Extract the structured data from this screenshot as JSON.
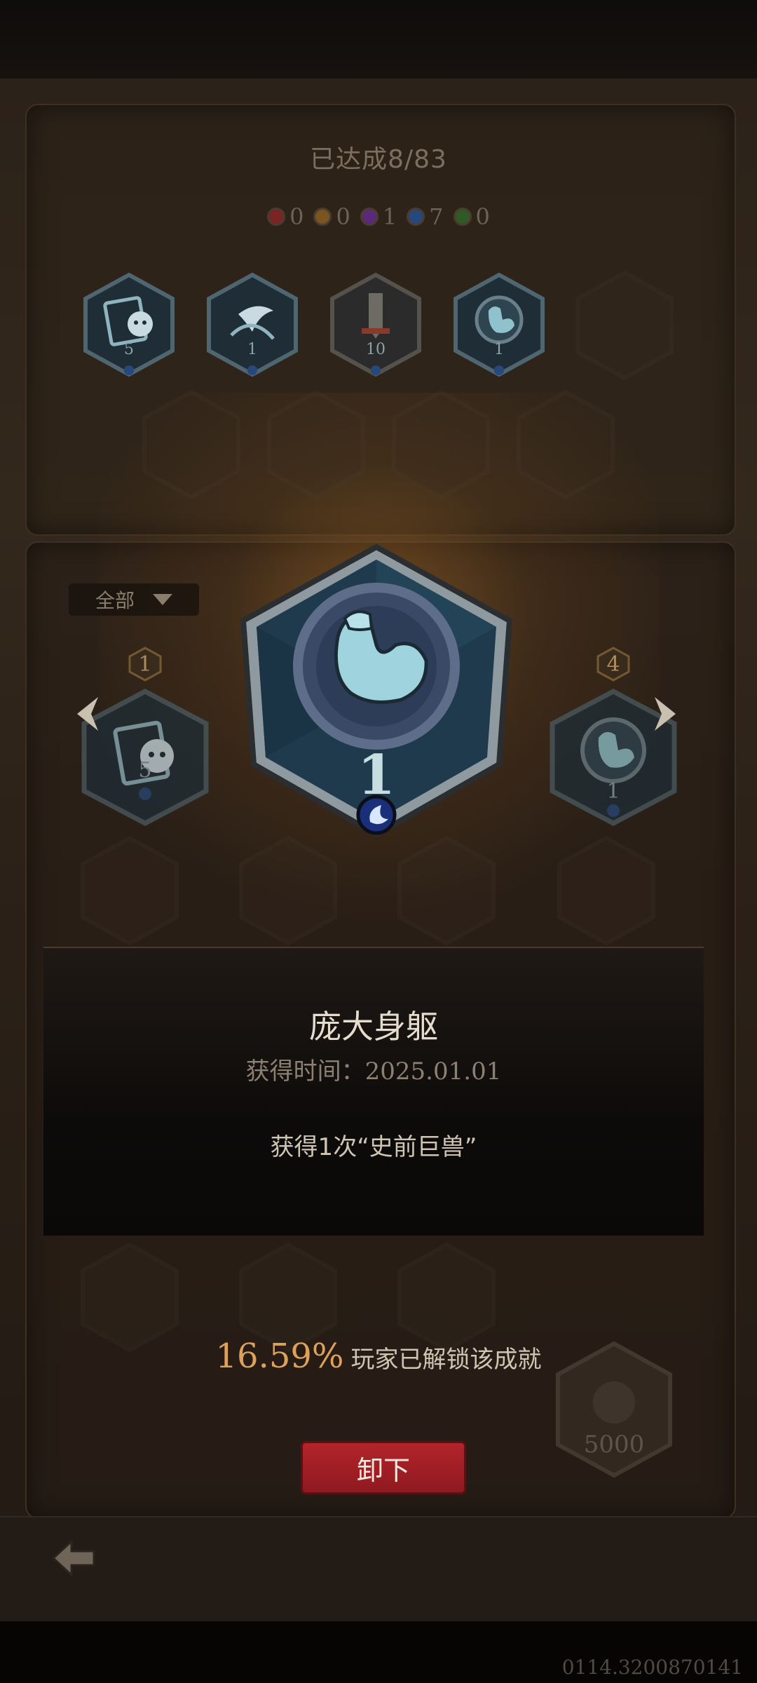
{
  "summary": {
    "achieved_label": "已达成8/83"
  },
  "gem_counts": [
    {
      "color": "#c43a3a",
      "count": "0"
    },
    {
      "color": "#c78b2e",
      "count": "0"
    },
    {
      "color": "#8a3bb5",
      "count": "1"
    },
    {
      "color": "#3a6cc4",
      "count": "7"
    },
    {
      "color": "#4ba83a",
      "count": "0"
    }
  ],
  "unlocked_row": [
    {
      "icon": "ghost-card-icon",
      "count": "5"
    },
    {
      "icon": "claw-moon-icon",
      "count": "1"
    },
    {
      "icon": "sword-icon",
      "count": "10"
    },
    {
      "icon": "muscle-arm-icon",
      "count": "1"
    }
  ],
  "filter": {
    "label": "全部"
  },
  "carousel": {
    "left": {
      "icon": "ghost-card-icon",
      "count": "5",
      "rank": "1"
    },
    "right": {
      "icon": "muscle-arm-icon",
      "count": "1",
      "rank": "4"
    },
    "center": {
      "icon": "muscle-arm-icon",
      "count": "1"
    }
  },
  "achievement": {
    "name": "庞大身躯",
    "time_label": "获得时间：",
    "time_value": "2025.01.01",
    "description": "获得1次“史前巨兽”"
  },
  "unlock_rate": {
    "percent": "16.59%",
    "text": "玩家已解锁该成就"
  },
  "locked_badge": {
    "value": "5000"
  },
  "buttons": {
    "unequip": "卸下"
  },
  "serial": "0114.3200870141"
}
